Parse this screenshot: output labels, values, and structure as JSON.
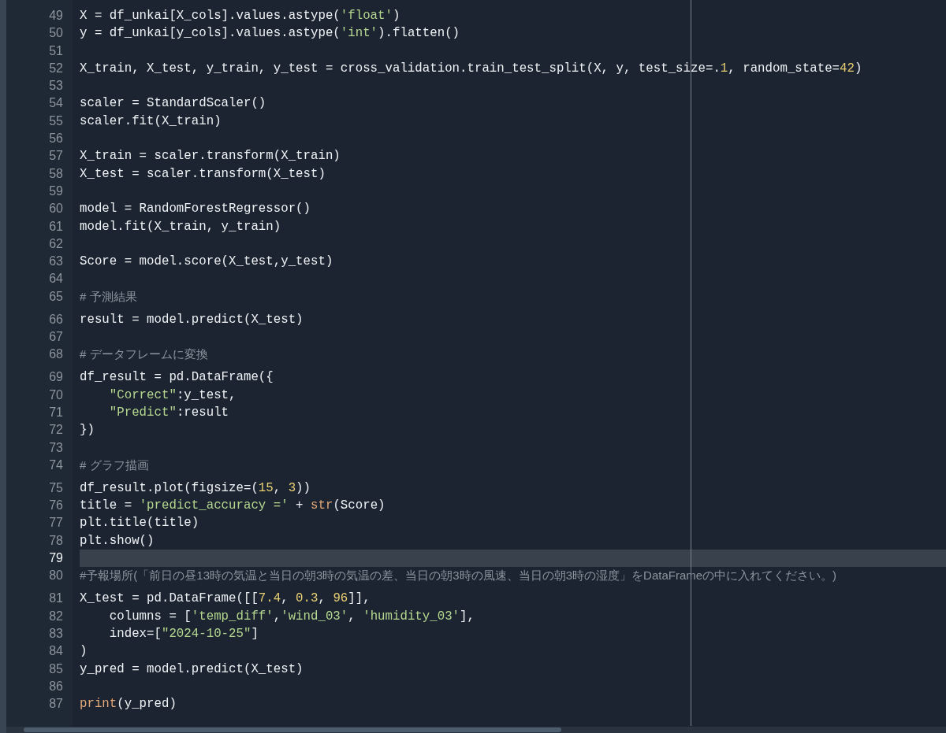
{
  "editor": {
    "lines": [
      {
        "number": "49",
        "current": false,
        "tokens": [
          {
            "kind": "plain",
            "text": "X = df_unkai[X_cols].values.astype("
          },
          {
            "kind": "string",
            "text": "'float'"
          },
          {
            "kind": "plain",
            "text": ")"
          }
        ]
      },
      {
        "number": "50",
        "current": false,
        "tokens": [
          {
            "kind": "plain",
            "text": "y = df_unkai[y_cols].values.astype("
          },
          {
            "kind": "string",
            "text": "'int'"
          },
          {
            "kind": "plain",
            "text": ").flatten()"
          }
        ]
      },
      {
        "number": "51",
        "current": false
      },
      {
        "number": "52",
        "current": false,
        "tokens": [
          {
            "kind": "plain",
            "text": "X_train, X_test, y_train, y_test = cross_validation.train_test_split(X, y, test_size=."
          },
          {
            "kind": "number",
            "text": "1"
          },
          {
            "kind": "plain",
            "text": ", random_state="
          },
          {
            "kind": "number",
            "text": "42"
          },
          {
            "kind": "plain",
            "text": ")"
          }
        ]
      },
      {
        "number": "53",
        "current": false
      },
      {
        "number": "54",
        "current": false,
        "tokens": [
          {
            "kind": "plain",
            "text": "scaler = StandardScaler()"
          }
        ]
      },
      {
        "number": "55",
        "current": false,
        "tokens": [
          {
            "kind": "plain",
            "text": "scaler.fit(X_train)"
          }
        ]
      },
      {
        "number": "56",
        "current": false
      },
      {
        "number": "57",
        "current": false,
        "tokens": [
          {
            "kind": "plain",
            "text": "X_train = scaler.transform(X_train)"
          }
        ]
      },
      {
        "number": "58",
        "current": false,
        "tokens": [
          {
            "kind": "plain",
            "text": "X_test = scaler.transform(X_test)"
          }
        ]
      },
      {
        "number": "59",
        "current": false
      },
      {
        "number": "60",
        "current": false,
        "tokens": [
          {
            "kind": "plain",
            "text": "model = RandomForestRegressor()"
          }
        ]
      },
      {
        "number": "61",
        "current": false,
        "tokens": [
          {
            "kind": "plain",
            "text": "model.fit(X_train, y_train)"
          }
        ]
      },
      {
        "number": "62",
        "current": false
      },
      {
        "number": "63",
        "current": false,
        "tokens": [
          {
            "kind": "plain",
            "text": "Score = model.score(X_test,y_test)"
          }
        ]
      },
      {
        "number": "64",
        "current": false
      },
      {
        "number": "65",
        "current": false,
        "tokens": [
          {
            "kind": "comment",
            "text": "# 予測結果"
          }
        ]
      },
      {
        "number": "66",
        "current": false,
        "tokens": [
          {
            "kind": "plain",
            "text": "result = model.predict(X_test)"
          }
        ]
      },
      {
        "number": "67",
        "current": false
      },
      {
        "number": "68",
        "current": false,
        "tokens": [
          {
            "kind": "comment",
            "text": "# データフレームに変換"
          }
        ]
      },
      {
        "number": "69",
        "current": false,
        "tokens": [
          {
            "kind": "plain",
            "text": "df_result = pd.DataFrame({"
          }
        ]
      },
      {
        "number": "70",
        "current": false,
        "tokens": [
          {
            "kind": "string",
            "text": "    \"Correct\""
          },
          {
            "kind": "plain",
            "text": ":y_test,"
          }
        ]
      },
      {
        "number": "71",
        "current": false,
        "tokens": [
          {
            "kind": "string",
            "text": "    \"Predict\""
          },
          {
            "kind": "plain",
            "text": ":result"
          }
        ]
      },
      {
        "number": "72",
        "current": false,
        "tokens": [
          {
            "kind": "plain",
            "text": "})"
          }
        ]
      },
      {
        "number": "73",
        "current": false
      },
      {
        "number": "74",
        "current": false,
        "tokens": [
          {
            "kind": "comment",
            "text": "# グラフ描画"
          }
        ]
      },
      {
        "number": "75",
        "current": false,
        "tokens": [
          {
            "kind": "plain",
            "text": "df_result.plot(figsize=("
          },
          {
            "kind": "number",
            "text": "15"
          },
          {
            "kind": "plain",
            "text": ", "
          },
          {
            "kind": "number",
            "text": "3"
          },
          {
            "kind": "plain",
            "text": "))"
          }
        ]
      },
      {
        "number": "76",
        "current": false,
        "tokens": [
          {
            "kind": "plain",
            "text": "title = "
          },
          {
            "kind": "string",
            "text": "'predict_accuracy ='"
          },
          {
            "kind": "plain",
            "text": " + "
          },
          {
            "kind": "builtin",
            "text": "str"
          },
          {
            "kind": "plain",
            "text": "(Score)"
          }
        ]
      },
      {
        "number": "77",
        "current": false,
        "tokens": [
          {
            "kind": "plain",
            "text": "plt.title(title)"
          }
        ]
      },
      {
        "number": "78",
        "current": false,
        "tokens": [
          {
            "kind": "plain",
            "text": "plt.show()"
          }
        ]
      },
      {
        "number": "79",
        "current": true
      },
      {
        "number": "80",
        "current": false,
        "tokens": [
          {
            "kind": "comment",
            "text": "#予報場所(「前日の昼13時の気温と当日の朝3時の気温の差、当日の朝3時の風速、当日の朝3時の湿度」をDataFrameの中に入れてください。)"
          }
        ]
      },
      {
        "number": "81",
        "current": false,
        "tokens": [
          {
            "kind": "plain",
            "text": "X_test = pd.DataFrame([["
          },
          {
            "kind": "number",
            "text": "7.4"
          },
          {
            "kind": "plain",
            "text": ", "
          },
          {
            "kind": "number",
            "text": "0.3"
          },
          {
            "kind": "plain",
            "text": ", "
          },
          {
            "kind": "number",
            "text": "96"
          },
          {
            "kind": "plain",
            "text": "]],"
          }
        ]
      },
      {
        "number": "82",
        "current": false,
        "tokens": [
          {
            "kind": "plain",
            "text": "    columns = ["
          },
          {
            "kind": "string",
            "text": "'temp_diff'"
          },
          {
            "kind": "plain",
            "text": ","
          },
          {
            "kind": "string",
            "text": "'wind_03'"
          },
          {
            "kind": "plain",
            "text": ", "
          },
          {
            "kind": "string",
            "text": "'humidity_03'"
          },
          {
            "kind": "plain",
            "text": "],"
          }
        ]
      },
      {
        "number": "83",
        "current": false,
        "tokens": [
          {
            "kind": "plain",
            "text": "    index=["
          },
          {
            "kind": "string",
            "text": "\"2024-10-25\""
          },
          {
            "kind": "plain",
            "text": "]"
          }
        ]
      },
      {
        "number": "84",
        "current": false,
        "tokens": [
          {
            "kind": "plain",
            "text": ")"
          }
        ]
      },
      {
        "number": "85",
        "current": false,
        "tokens": [
          {
            "kind": "plain",
            "text": "y_pred = model.predict(X_test)"
          }
        ]
      },
      {
        "number": "86",
        "current": false
      },
      {
        "number": "87",
        "current": false,
        "tokens": [
          {
            "kind": "builtin",
            "text": "print"
          },
          {
            "kind": "plain",
            "text": "(y_pred)"
          }
        ]
      }
    ]
  }
}
